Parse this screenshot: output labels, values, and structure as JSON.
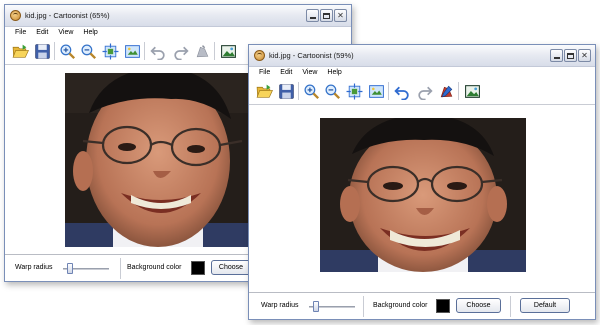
{
  "windows": [
    {
      "title": "kid.jpg - Cartoonist (65%)",
      "menu": [
        "File",
        "Edit",
        "View",
        "Help"
      ],
      "bottom": {
        "warp_label": "Warp radius",
        "bg_label": "Background color",
        "choose_label": "Choose",
        "bg_color": "#000000"
      },
      "photo_variant": "original"
    },
    {
      "title": "kid.jpg - Cartoonist (59%)",
      "menu": [
        "File",
        "Edit",
        "View",
        "Help"
      ],
      "bottom": {
        "warp_label": "Warp radius",
        "bg_label": "Background color",
        "choose_label": "Choose",
        "default_label": "Default",
        "bg_color": "#000000"
      },
      "photo_variant": "warped"
    }
  ],
  "toolbar_icons": [
    "open-folder-icon",
    "save-disk-icon",
    "zoom-in-icon",
    "zoom-out-icon",
    "fit-to-window-icon",
    "actual-size-icon",
    "undo-icon",
    "redo-icon",
    "reset-warp-icon",
    "export-image-icon"
  ],
  "colors": {
    "titlebar": "#e6e9f1",
    "window_border": "#7a8fb8",
    "accent_blue": "#2f6bd0"
  }
}
